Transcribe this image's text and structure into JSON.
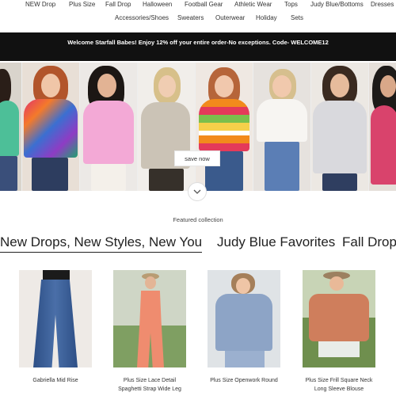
{
  "nav": {
    "row1": [
      "NEW Drop",
      "Plus Size",
      "Fall Drop",
      "Halloween",
      "Football Gear",
      "Athletic Wear",
      "Tops",
      "Judy Blue/Bottoms",
      "Dresses"
    ],
    "row2": [
      "Accessories/Shoes",
      "Sweaters",
      "Outerwear",
      "Holiday",
      "Sets"
    ]
  },
  "banner": {
    "text": "Welcome Starfall Babes! Enjoy 12% off your entire order-No exceptions. Code- WELCOME12"
  },
  "hero": {
    "cta_label": "save now",
    "scroll_icon": "chevron-down-icon"
  },
  "featured": {
    "label": "Featured collection",
    "tabs": [
      "New Drops, New Styles, New You",
      "Judy Blue Favorites",
      "Fall Drop"
    ]
  },
  "products": [
    {
      "name": "Gabriella Mid Rise"
    },
    {
      "name": "Plus Size Lace Detail Spaghetti Strap Wide Leg"
    },
    {
      "name": "Plus Size Openwork Round"
    },
    {
      "name": "Plus Size Frill Square Neck Long Sleeve Blouse"
    }
  ],
  "colors": {
    "banner_bg": "#111111",
    "banner_text": "#ffffff",
    "text": "#222222"
  }
}
